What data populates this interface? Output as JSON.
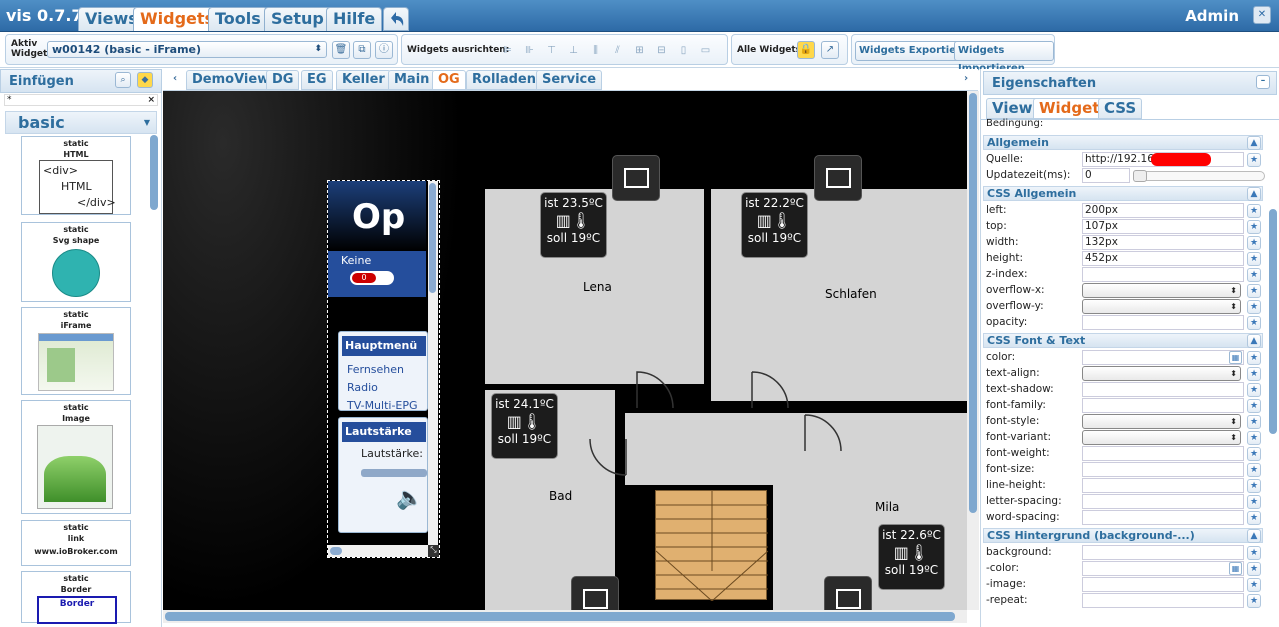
{
  "app": {
    "name": "vis 0.7.7",
    "user": "Admin",
    "close_icon": "close-icon",
    "undo_icon": "undo-icon"
  },
  "menu": [
    {
      "label": "Views"
    },
    {
      "label": "Widgets",
      "active": true
    },
    {
      "label": "Tools"
    },
    {
      "label": "Setup"
    },
    {
      "label": "Hilfe"
    }
  ],
  "toolbar": {
    "active_widget_label": "Aktiv Widget:",
    "active_widget_value": "w00142 (basic - iFrame)",
    "align_label": "Widgets ausrichten:",
    "all_widgets_label": "Alle Widgets:",
    "export_label": "Widgets Exportieren",
    "import_label": "Widgets Importieren"
  },
  "left_panel": {
    "title": "Einfügen",
    "filter_value": "*",
    "filter_clear": "×",
    "category": "basic",
    "widgets": [
      {
        "line1": "static",
        "line2": "HTML",
        "preview": "<div>|HTML|</div>"
      },
      {
        "line1": "static",
        "line2": "Svg shape"
      },
      {
        "line1": "static",
        "line2": "iFrame"
      },
      {
        "line1": "static",
        "line2": "Image"
      },
      {
        "line1": "static",
        "line2": "link",
        "line3": "www.ioBroker.com"
      },
      {
        "line1": "static",
        "line2": "Border",
        "line3": "Border"
      }
    ]
  },
  "view_tabs": [
    "DemoView",
    "DG",
    "EG",
    "Keller",
    "Main",
    "OG",
    "Rolladen",
    "Service"
  ],
  "active_view": "OG",
  "floorplan": {
    "iframe": {
      "title": "Op",
      "subtitle": "Keine",
      "toggle": "0",
      "menu_title": "Hauptmenü",
      "menu_items": [
        "Fernsehen",
        "Radio",
        "TV-Multi-EPG"
      ],
      "volume_title": "Lautstärke",
      "volume_label": "Lautstärke:"
    },
    "rooms": [
      {
        "name": "Lena"
      },
      {
        "name": "Schlafen"
      },
      {
        "name": "Bad"
      },
      {
        "name": "Mila"
      }
    ],
    "thermostats": [
      {
        "ist": "ist 23.5ºC",
        "soll": "soll 19ºC"
      },
      {
        "ist": "ist 22.2ºC",
        "soll": "soll 19ºC"
      },
      {
        "ist": "ist 24.1ºC",
        "soll": "soll 19ºC"
      },
      {
        "ist": "ist 22.6ºC",
        "soll": "soll 19ºC"
      }
    ]
  },
  "properties": {
    "title": "Eigenschaften",
    "tabs": [
      "View",
      "Widget",
      "CSS"
    ],
    "active_tab": "Widget",
    "cut_row": "Bedingung:",
    "sections": [
      {
        "title": "Allgemein",
        "rows": [
          {
            "label": "Quelle:",
            "value": "http://192.168."
          },
          {
            "label": "Updatezeit(ms):",
            "value": "0"
          }
        ]
      },
      {
        "title": "CSS Allgemein",
        "rows": [
          {
            "label": "left:",
            "value": "200px"
          },
          {
            "label": "top:",
            "value": "107px"
          },
          {
            "label": "width:",
            "value": "132px"
          },
          {
            "label": "height:",
            "value": "452px"
          },
          {
            "label": "z-index:",
            "value": ""
          },
          {
            "label": "overflow-x:",
            "value": ""
          },
          {
            "label": "overflow-y:",
            "value": ""
          },
          {
            "label": "opacity:",
            "value": ""
          }
        ]
      },
      {
        "title": "CSS Font & Text",
        "rows": [
          {
            "label": "color:",
            "value": ""
          },
          {
            "label": "text-align:",
            "value": ""
          },
          {
            "label": "text-shadow:",
            "value": ""
          },
          {
            "label": "font-family:",
            "value": ""
          },
          {
            "label": "font-style:",
            "value": ""
          },
          {
            "label": "font-variant:",
            "value": ""
          },
          {
            "label": "font-weight:",
            "value": ""
          },
          {
            "label": "font-size:",
            "value": ""
          },
          {
            "label": "line-height:",
            "value": ""
          },
          {
            "label": "letter-spacing:",
            "value": ""
          },
          {
            "label": "word-spacing:",
            "value": ""
          }
        ]
      },
      {
        "title": "CSS Hintergrund (background-...)",
        "rows": [
          {
            "label": "background:",
            "value": ""
          },
          {
            "label": "-color:",
            "value": ""
          },
          {
            "label": "-image:",
            "value": ""
          },
          {
            "label": "-repeat:",
            "value": ""
          }
        ]
      }
    ]
  }
}
